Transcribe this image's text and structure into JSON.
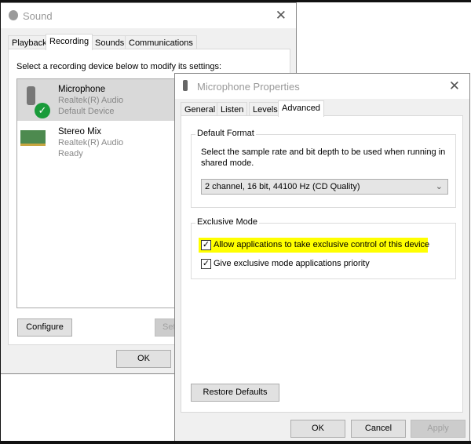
{
  "sound": {
    "title": "Sound",
    "tabs": [
      "Playback",
      "Recording",
      "Sounds",
      "Communications"
    ],
    "active_tab": "Recording",
    "instruction": "Select a recording device below to modify its settings:",
    "devices": [
      {
        "name": "Microphone",
        "driver": "Realtek(R) Audio",
        "status": "Default Device",
        "icon": "microphone-icon",
        "selected": true
      },
      {
        "name": "Stereo Mix",
        "driver": "Realtek(R) Audio",
        "status": "Ready",
        "icon": "sound-card-icon",
        "selected": false
      }
    ],
    "configure": "Configure",
    "set": "Set",
    "ok": "OK"
  },
  "props": {
    "title": "Microphone Properties",
    "tabs": [
      "General",
      "Listen",
      "Levels",
      "Advanced"
    ],
    "active_tab": "Advanced",
    "default_format": {
      "legend": "Default Format",
      "description": "Select the sample rate and bit depth to be used when running in shared mode.",
      "selected": "2 channel, 16 bit, 44100 Hz (CD Quality)"
    },
    "exclusive": {
      "legend": "Exclusive Mode",
      "options": [
        {
          "label": "Allow applications to take exclusive control of this device",
          "checked": true,
          "highlight": "#ffff00"
        },
        {
          "label": "Give exclusive mode applications priority",
          "checked": true
        }
      ]
    },
    "restore": "Restore Defaults",
    "ok": "OK",
    "cancel": "Cancel",
    "apply": "Apply"
  }
}
